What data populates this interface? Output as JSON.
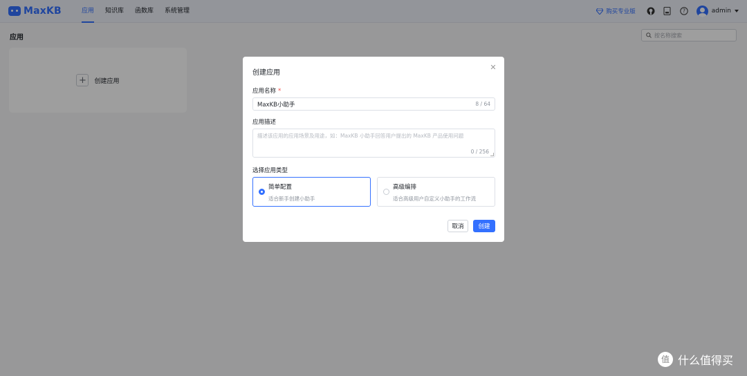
{
  "app": {
    "logo_text": "MaxKB"
  },
  "nav": {
    "items": [
      "应用",
      "知识库",
      "函数库",
      "系统管理"
    ],
    "active_index": 0
  },
  "header_right": {
    "pro_link": "购买专业版",
    "username": "admin"
  },
  "page": {
    "title": "应用",
    "search_placeholder": "按名称搜索",
    "create_card_label": "创建应用"
  },
  "dialog": {
    "title": "创建应用",
    "name_label": "应用名称",
    "name_value": "MaxKB小助手",
    "name_counter": "8 / 64",
    "desc_label": "应用描述",
    "desc_placeholder": "描述该应用的应用场景及用途，如：MaxKB 小助手回答用户提出的 MaxKB 产品使用问题",
    "desc_counter": "0 / 256",
    "type_label": "选择应用类型",
    "types": [
      {
        "title": "简单配置",
        "desc": "适合新手创建小助手",
        "selected": true
      },
      {
        "title": "高级编排",
        "desc": "适合高级用户自定义小助手的工作流",
        "selected": false
      }
    ],
    "cancel_label": "取消",
    "create_label": "创建"
  },
  "watermark": {
    "text": "什么值得买"
  },
  "colors": {
    "accent": "#3370ff",
    "required": "#f54a45"
  }
}
